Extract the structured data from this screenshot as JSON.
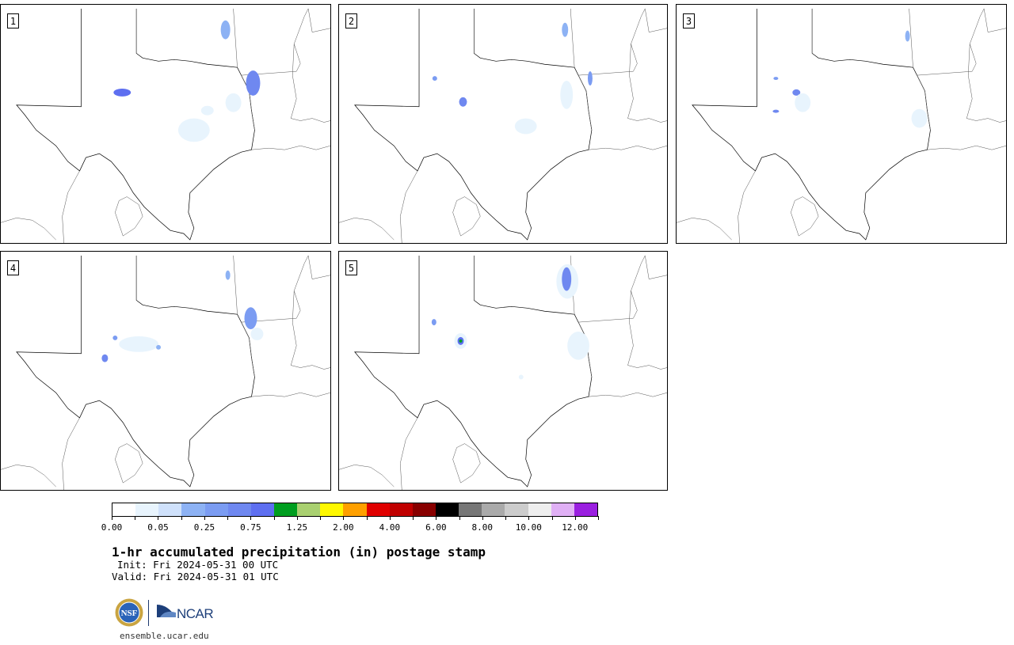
{
  "panels": [
    {
      "label": "1"
    },
    {
      "label": "2"
    },
    {
      "label": "3"
    },
    {
      "label": "4"
    },
    {
      "label": "5"
    }
  ],
  "colorbar": {
    "colors": [
      "#ffffff",
      "#e8f4fd",
      "#cfe1fb",
      "#8db2f4",
      "#7b9cf2",
      "#6f88f0",
      "#5e6ff0",
      "#009e20",
      "#a9d070",
      "#fff800",
      "#ffa000",
      "#e00000",
      "#c00000",
      "#880000",
      "#000000",
      "#777777",
      "#aaaaaa",
      "#cccccc",
      "#eeeeee",
      "#e0b0f5",
      "#9a1fe0"
    ],
    "tick_labels": [
      "0.00",
      "0.05",
      "0.25",
      "0.75",
      "1.25",
      "2.00",
      "4.00",
      "6.00",
      "8.00",
      "10.00",
      "12.00"
    ]
  },
  "title": "1-hr accumulated precipitation (in) postage stamp",
  "init": "Init: Fri 2024-05-31 00 UTC",
  "valid": "Valid: Fri 2024-05-31 01 UTC",
  "logos": {
    "nsf": "NSF",
    "ncar": "NCAR"
  },
  "website": "ensemble.ucar.edu"
}
